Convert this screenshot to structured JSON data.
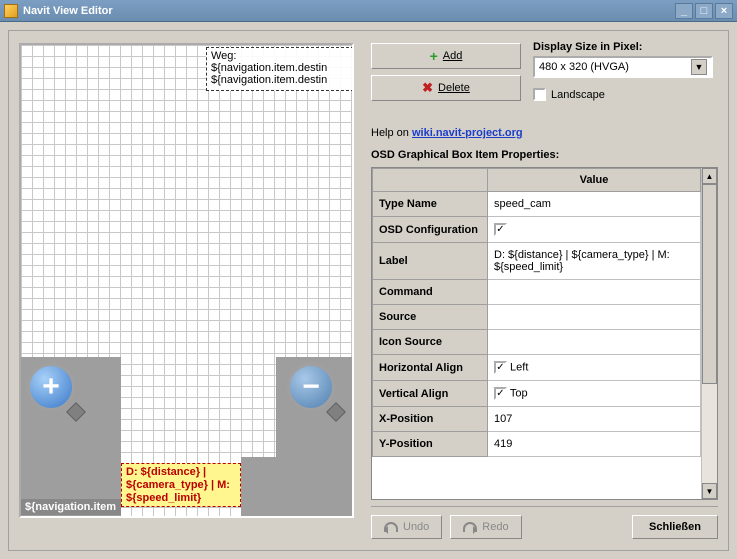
{
  "title": "Navit View Editor",
  "buttons": {
    "add": "Add",
    "delete": "Delete",
    "undo": "Undo",
    "redo": "Redo",
    "close": "Schließen"
  },
  "display": {
    "label": "Display Size in Pixel:",
    "value": "480 x 320 (HVGA)",
    "landscape": "Landscape"
  },
  "help": {
    "prefix": "Help on ",
    "link": "wiki.navit-project.org"
  },
  "props_title": "OSD Graphical Box Item Properties:",
  "table": {
    "header_blank": "",
    "header_value": "Value",
    "rows": [
      {
        "label": "Type Name",
        "value": "speed_cam",
        "type": "text"
      },
      {
        "label": "OSD Configuration",
        "value": "",
        "type": "check",
        "checked": true
      },
      {
        "label": "Label",
        "value": "D: ${distance} | ${camera_type} | M: ${speed_limit}",
        "type": "text"
      },
      {
        "label": "Command",
        "value": "",
        "type": "text"
      },
      {
        "label": "Source",
        "value": "",
        "type": "text"
      },
      {
        "label": "Icon Source",
        "value": "",
        "type": "text"
      },
      {
        "label": "Horizontal Align",
        "value": "Left",
        "type": "check",
        "checked": true
      },
      {
        "label": "Vertical Align",
        "value": "Top",
        "type": "check",
        "checked": true
      },
      {
        "label": "X-Position",
        "value": "107",
        "type": "text"
      },
      {
        "label": "Y-Position",
        "value": "419",
        "type": "text"
      }
    ]
  },
  "canvas": {
    "topbox": "Weg:\n${navigation.item.destin\n${navigation.item.destin",
    "yellow": "D: ${distance} |\n${camera_type} | M:\n${speed_limit}",
    "navstrip": "${navigation.item"
  }
}
